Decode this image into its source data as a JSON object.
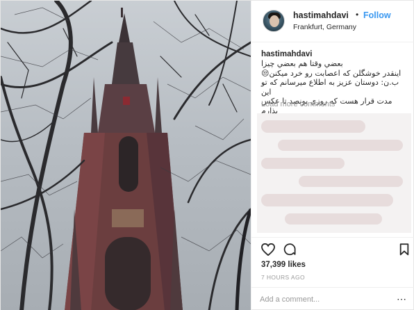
{
  "post": {
    "username": "hastimahdavi",
    "separator": "•",
    "follow_label": "Follow",
    "location": "Frankfurt, Germany"
  },
  "caption": {
    "username": "hastimahdavi",
    "lines": [
      "بعضي وقتا هم بعضي چيزا",
      "اينقدر خوشگلن كه اعصابت رو خرد ميكنن😒",
      "ب.ن: دوستان عزيز به اطلاع ميرسانم كه تو اين",
      "مدت قرار هست كه روزي پونصد تا عكس بذارم",
      "."
    ]
  },
  "comments": {
    "load_more_label": "Load more comments"
  },
  "actions": {
    "like_icon": "heart-icon",
    "comment_icon": "comment-bubble-icon",
    "save_icon": "bookmark-icon"
  },
  "stats": {
    "likes": "37,399 likes",
    "time_ago": "7 HOURS AGO"
  },
  "comment_input": {
    "placeholder": "Add a comment..."
  },
  "colors": {
    "link_blue": "#3897f0",
    "text": "#262626",
    "muted": "#999999"
  }
}
